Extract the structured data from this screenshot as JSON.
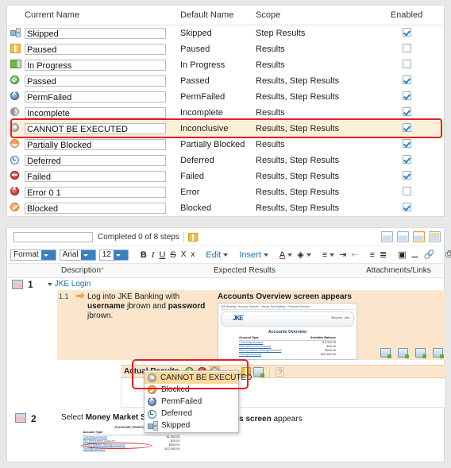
{
  "status_table": {
    "columns": [
      "Current Name",
      "Default Name",
      "Scope",
      "Enabled"
    ],
    "rows": [
      {
        "icon": "skipped-icon",
        "current": "Skipped",
        "default": "Skipped",
        "scope": "Step Results",
        "enabled": true
      },
      {
        "icon": "paused-icon",
        "current": "Paused",
        "default": "Paused",
        "scope": "Results",
        "enabled": false
      },
      {
        "icon": "in-progress-icon",
        "current": "In Progress",
        "default": "In Progress",
        "scope": "Results",
        "enabled": false
      },
      {
        "icon": "passed-icon",
        "current": "Passed",
        "default": "Passed",
        "scope": "Results, Step Results",
        "enabled": true
      },
      {
        "icon": "permfailed-icon",
        "current": "PermFailed",
        "default": "PermFailed",
        "scope": "Results, Step Results",
        "enabled": true
      },
      {
        "icon": "incomplete-icon",
        "current": "Incomplete",
        "default": "Incomplete",
        "scope": "Results",
        "enabled": true
      },
      {
        "icon": "inconclusive-icon",
        "current": "CANNOT BE EXECUTED",
        "default": "Inconclusive",
        "scope": "Results, Step Results",
        "enabled": true
      },
      {
        "icon": "partially-blocked-icon",
        "current": "Partially Blocked",
        "default": "Partially Blocked",
        "scope": "Results",
        "enabled": true
      },
      {
        "icon": "deferred-icon",
        "current": "Deferred",
        "default": "Deferred",
        "scope": "Results, Step Results",
        "enabled": true
      },
      {
        "icon": "failed-icon",
        "current": "Failed",
        "default": "Failed",
        "scope": "Results, Step Results",
        "enabled": true
      },
      {
        "icon": "error-icon",
        "current": "Error 0 1",
        "default": "Error",
        "scope": "Results, Step Results",
        "enabled": false
      },
      {
        "icon": "blocked-icon",
        "current": "Blocked",
        "default": "Blocked",
        "scope": "Results, Step Results",
        "enabled": true
      }
    ],
    "highlighted_row_index": 6
  },
  "editor": {
    "topbar": {
      "progress_value": "",
      "completed_text": "Completed 0 of 8 steps",
      "pause_icon": "paused-icon",
      "view_buttons": [
        "view-grid-icon",
        "view-list-icon",
        "view-columns-icon",
        "view-split-icon"
      ],
      "selected_view_index": 2
    },
    "format_toolbar": {
      "format_select": "Format",
      "font_select": "Arial",
      "size_select": "12",
      "bold": "B",
      "italic": "I",
      "underline": "U",
      "strike": "S",
      "subscript": "X",
      "superscript": "x",
      "edit_menu": "Edit",
      "insert_menu": "Insert",
      "text_color_icon": "text-color-icon",
      "highlight-color_icon": "highlight-color-icon",
      "align_icon": "align-left-icon",
      "indent_icon": "indent-increase-icon",
      "outdent_icon": "indent-decrease-icon",
      "bullet_list_icon": "bullet-list-icon",
      "number_list_icon": "numbered-list-icon",
      "image_icon": "insert-image-icon",
      "media_icon": "insert-media-icon",
      "link_icon": "insert-link-icon",
      "print_icon": "print-icon"
    },
    "column_headers": {
      "c1": "",
      "description": "Description",
      "description_required": "*",
      "expected_results": "Expected Results",
      "attachments": "Attachments/Links"
    },
    "steps": [
      {
        "number": "1",
        "group_label": "JKE Login",
        "sub_number": "1.1",
        "description_prefix": "Log into JKE Banking with ",
        "description_b1": "username",
        "description_mid": " jbrown and ",
        "description_b2": "password",
        "description_suffix": " jbrown.",
        "expected_title": "Accounts Overview screen appears"
      },
      {
        "number": "2",
        "description_prefix": "Select ",
        "description_bold": "Money Market Savings Acco",
        "expected_bold": "details screen",
        "expected_tail": " appears"
      }
    ],
    "mini_screenshot": {
      "nav_items": [
        "JKE Banking",
        "Account Services",
        "Money That Matters",
        "Financial Services"
      ],
      "logo": "JKE",
      "welcome": "Welcome, Julie",
      "heading": "Accounts Overview",
      "col_type": "Account Type",
      "col_balance": "Available Balance",
      "accounts": [
        {
          "name": "Checking Account",
          "balance": "$1,000.00"
        },
        {
          "name": "IRA Retirement Account",
          "balance": "$25.00"
        },
        {
          "name": "Money Market Savings Account",
          "balance": "$500.00"
        },
        {
          "name": "Savings Account",
          "balance": "$12,500.00"
        }
      ],
      "circled_account_index": 2
    },
    "attachment_icons": [
      "add-screenshot-icon",
      "add-attachment-icon",
      "add-comment-icon",
      "add-file-icon"
    ],
    "actual_results": {
      "label": "Actual Results",
      "pass_icon": "pass-icon",
      "fail_icon": "fail-icon",
      "status_dropdown_icon": "inconclusive-icon",
      "dropdown_arrow_icon": "chevron-down-icon",
      "pause_icon": "paused-icon",
      "export_icon": "export-icon",
      "help_icon": "help-icon"
    },
    "status_menu": {
      "items": [
        {
          "label": "CANNOT BE EXECUTED",
          "icon": "inconclusive-icon",
          "selected": true
        },
        {
          "label": "Blocked",
          "icon": "blocked-icon",
          "selected": false
        },
        {
          "label": "PermFailed",
          "icon": "permfailed-icon",
          "selected": false
        },
        {
          "label": "Deferred",
          "icon": "deferred-icon",
          "selected": false
        },
        {
          "label": "Skipped",
          "icon": "skipped-icon",
          "selected": false
        }
      ]
    }
  },
  "annotations": {
    "highlight_color": "#e81c23",
    "boxes": [
      "table-inconclusive-row",
      "status-dropdown-trigger"
    ]
  }
}
